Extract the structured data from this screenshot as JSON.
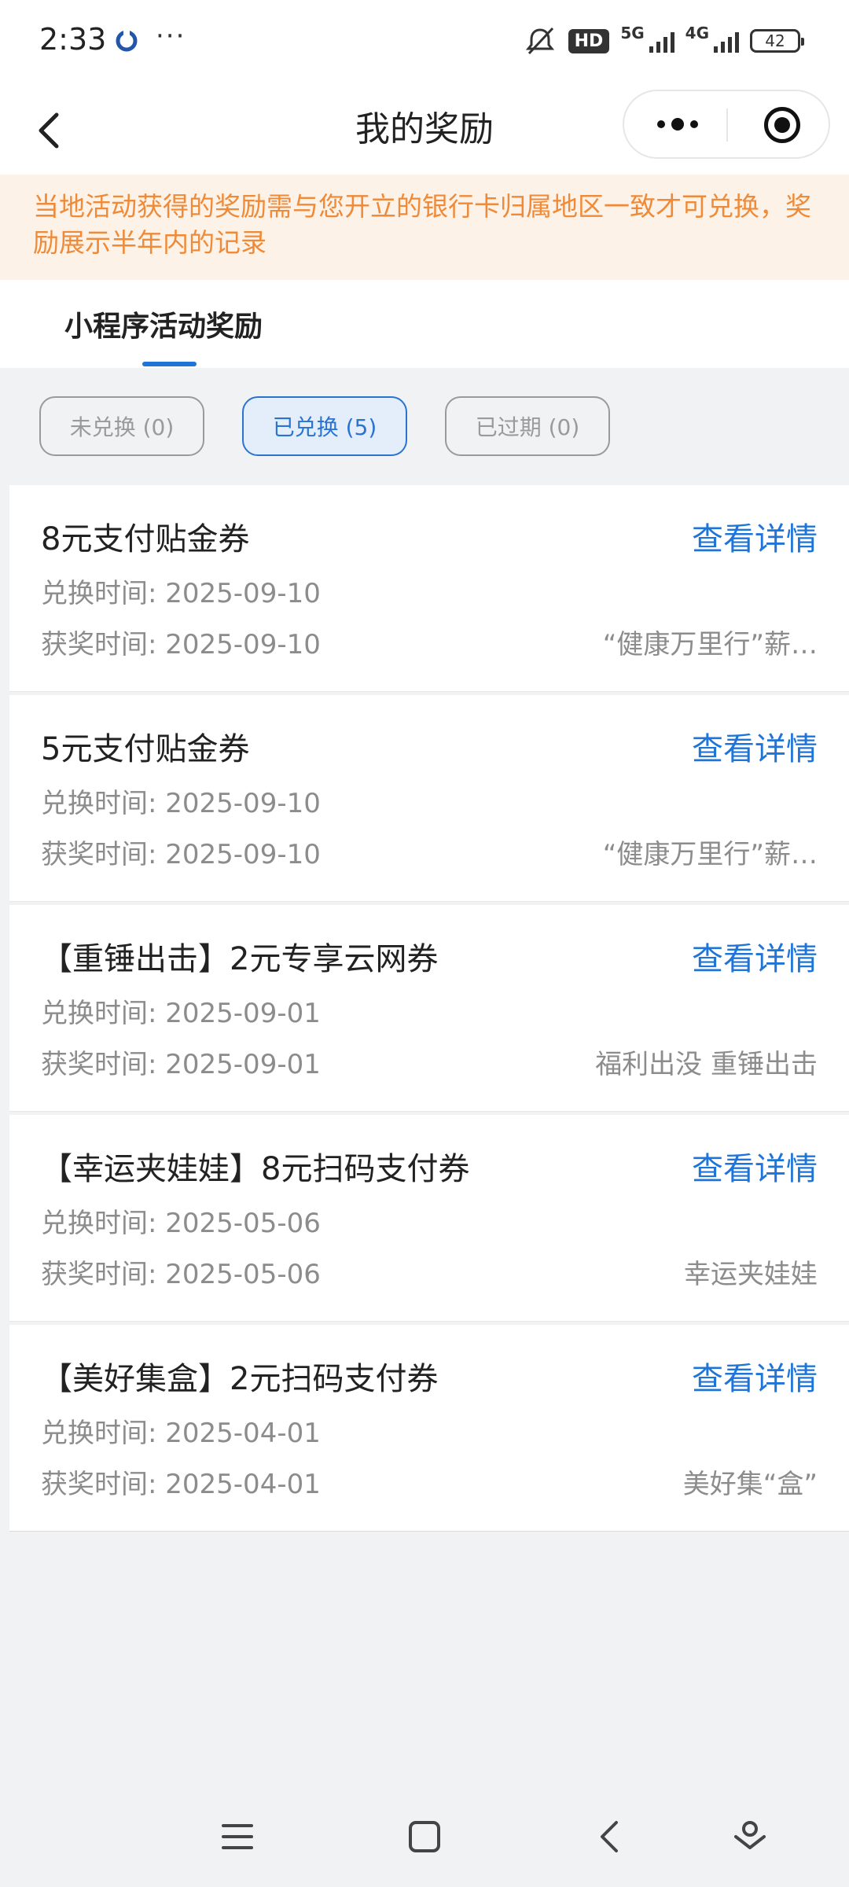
{
  "status_bar": {
    "time": "2:33",
    "more": "···",
    "hd_label": "HD",
    "net1": "5G",
    "net2": "4G",
    "battery": "42"
  },
  "navbar": {
    "title": "我的奖励"
  },
  "notice": {
    "text": "当地活动获得的奖励需与您开立的银行卡归属地区一致才可兑换，奖励展示半年内的记录",
    "color": "#ef8b38"
  },
  "tab": {
    "label": "小程序活动奖励"
  },
  "filters": {
    "unredeemed": "未兑换 (0)",
    "redeemed": "已兑换 (5)",
    "expired": "已过期 (0)",
    "selected": "redeemed"
  },
  "accent_color": "#1f74d8",
  "rewards": [
    {
      "title": "8元支付贴金券",
      "link": "查看详情",
      "redeem_time": "兑换时间: 2025-09-10",
      "win_time": "获奖时间: 2025-09-10",
      "source": "“健康万里行”薪…"
    },
    {
      "title": "5元支付贴金券",
      "link": "查看详情",
      "redeem_time": "兑换时间: 2025-09-10",
      "win_time": "获奖时间: 2025-09-10",
      "source": "“健康万里行”薪…"
    },
    {
      "title": "【重锤出击】2元专享云网券",
      "link": "查看详情",
      "redeem_time": "兑换时间: 2025-09-01",
      "win_time": "获奖时间: 2025-09-01",
      "source": "福利出没 重锤出击"
    },
    {
      "title": "【幸运夹娃娃】8元扫码支付券",
      "link": "查看详情",
      "redeem_time": "兑换时间: 2025-05-06",
      "win_time": "获奖时间: 2025-05-06",
      "source": "幸运夹娃娃"
    },
    {
      "title": "【美好集盒】2元扫码支付券",
      "link": "查看详情",
      "redeem_time": "兑换时间: 2025-04-01",
      "win_time": "获奖时间: 2025-04-01",
      "source": "美好集“盒”"
    }
  ]
}
